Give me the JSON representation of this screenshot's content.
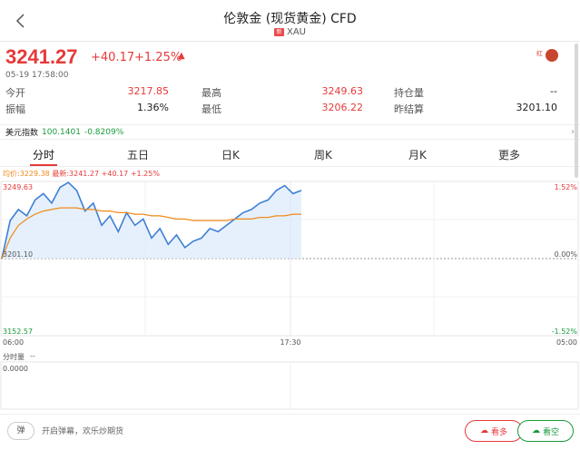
{
  "header": {
    "title": "伦敦金 (现货黄金) CFD",
    "flag_label": "新",
    "code": "XAU"
  },
  "quote": {
    "price": "3241.27",
    "change": "+40.17",
    "pct": "+1.25%",
    "time": "05-19 17:58:00",
    "avatar_label": "红",
    "trend_icon": "fire-icon"
  },
  "stats": {
    "row1": [
      {
        "label": "今开",
        "value": "3217.85"
      },
      {
        "label": "最高",
        "value": "3249.63"
      },
      {
        "label": "持仓量",
        "value": "--"
      }
    ],
    "row2": [
      {
        "label": "振幅",
        "value": "1.36%"
      },
      {
        "label": "最低",
        "value": "3206.22"
      },
      {
        "label": "昨结算",
        "value": "3201.10"
      }
    ]
  },
  "dxy": {
    "label": "美元指数",
    "value": "100.1401",
    "change": "-0.8209%"
  },
  "tabs": [
    "分时",
    "五日",
    "日K",
    "周K",
    "月K",
    "更多"
  ],
  "legend": {
    "avg": "均价:3229.38",
    "last": "最新:3241.27",
    "change": "+40.17",
    "pct": "+1.25%"
  },
  "chart_data": {
    "type": "line",
    "y_labels": {
      "top": "3249.63",
      "mid": "3201.10",
      "bottom": "3152.57"
    },
    "pct_labels": {
      "top": "1.52%",
      "mid": "0.00%",
      "bottom": "-1.52%"
    },
    "x_labels": [
      "06:00",
      "17:30",
      "05:00"
    ],
    "ylim": [
      3152.57,
      3249.63
    ],
    "prev_close": 3201.1,
    "series": [
      {
        "values": [
          3201,
          3225,
          3232,
          3228,
          3238,
          3242,
          3236,
          3246,
          3249,
          3244,
          3231,
          3236,
          3222,
          3228,
          3218,
          3230,
          3222,
          3226,
          3214,
          3220,
          3210,
          3216,
          3208,
          3212,
          3214,
          3220,
          3218,
          3222,
          3226,
          3230,
          3232,
          3236,
          3238,
          3244,
          3247,
          3242,
          3244
        ]
      },
      {
        "values": [
          3201,
          3214,
          3222,
          3226,
          3229,
          3231,
          3232,
          3233,
          3233,
          3233,
          3232,
          3232,
          3231,
          3231,
          3230,
          3230,
          3229,
          3229,
          3228,
          3228,
          3227,
          3226,
          3226,
          3225,
          3225,
          3225,
          3225,
          3225,
          3226,
          3226,
          3226,
          3227,
          3227,
          3228,
          3228,
          3229,
          3229
        ]
      }
    ]
  },
  "volume": {
    "label": "分时量",
    "sub": "--",
    "value": "0.0000"
  },
  "bottom": {
    "danmu_icon": "弹",
    "danmu_text": "开启弹幕，欢乐炒期货",
    "long_label": "看多",
    "short_label": "看空"
  },
  "colors": {
    "up": "#e63a3a",
    "down": "#1a9a3b",
    "price_line": "#3d7fd6",
    "avg_line": "#f08a1a"
  }
}
